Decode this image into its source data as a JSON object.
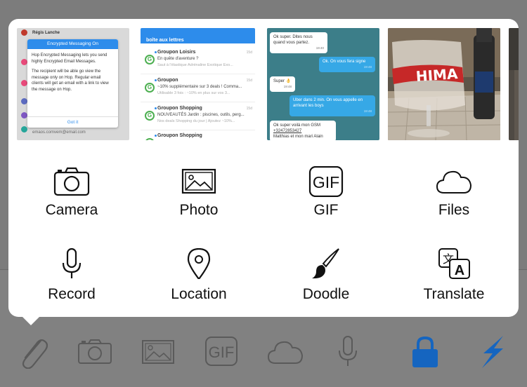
{
  "thumbnails": {
    "modal": {
      "list_top_name": "Régis Lanche",
      "title": "Encrypted Messaging On",
      "para1": "Hop Encrypted Messaging lets you send highly Encrypted Email Messages.",
      "para2": "The recipient will be able go view the message only on Hop. Regular email clients will get an email with a link to view the message on Hop.",
      "button": "Got it",
      "footer_email": "emaos.comvem@email.com"
    },
    "email_list": {
      "header": "boîte aux lettres",
      "mails": [
        {
          "sender": "Groupon Loisirs",
          "subject": "En quête d'aventure ?",
          "preview": "Saut à l'élastique Adrénaline Exotique Exo...",
          "time": "15d"
        },
        {
          "sender": "Groupon",
          "subject": "~10% supplémentaire sur 3 deals ! Comma...",
          "preview": "Utilisable 3 fois : ~10% en plus sur vos 3...",
          "time": "15d"
        },
        {
          "sender": "Groupon Shopping",
          "subject": "NOUVEAUTÉS Jardin : piscines, outils, perg...",
          "preview": "Nos deals Shopping du jour | Ajoutez ~10%...",
          "time": "15d"
        },
        {
          "sender": "Groupon Shopping",
          "subject": "",
          "preview": "",
          "time": ""
        }
      ]
    },
    "chat": {
      "m1": "Ok super. Dites nous quand vous partez.",
      "m1_time": "19:40",
      "m2": "Ok. On vous fera signe",
      "m2_time": "19:48",
      "m3": "Super 👌",
      "m3_time": "19:48",
      "m4": "Uber dans 2 min. On vous appelle en arrivant les boys",
      "m4_time": "19:48",
      "m5_line1": "Ok super voilà mon GSM",
      "m5_phone": "+32472853427",
      "m5_line3": "Matthias et mon mari Alain"
    },
    "photo_text": "HIMA"
  },
  "actions": [
    {
      "label": "Camera",
      "icon": "camera-icon"
    },
    {
      "label": "Photo",
      "icon": "photo-icon"
    },
    {
      "label": "GIF",
      "icon": "gif-icon",
      "icon_text": "GIF"
    },
    {
      "label": "Files",
      "icon": "cloud-icon"
    },
    {
      "label": "Record",
      "icon": "microphone-icon"
    },
    {
      "label": "Location",
      "icon": "location-pin-icon"
    },
    {
      "label": "Doodle",
      "icon": "brush-icon"
    },
    {
      "label": "Translate",
      "icon": "translate-icon",
      "icon_text_a": "文",
      "icon_text_b": "A"
    }
  ],
  "toolbar": {
    "gif_text": "GIF",
    "icons": [
      "paperclip-icon",
      "camera-icon",
      "photo-icon",
      "gif-icon",
      "cloud-icon",
      "microphone-icon",
      "lock-icon",
      "lightning-icon"
    ]
  },
  "colors": {
    "accent": "#1565c0",
    "toolbar_gray": "#5a5a5a",
    "dim_background": "#7f7f7f"
  }
}
